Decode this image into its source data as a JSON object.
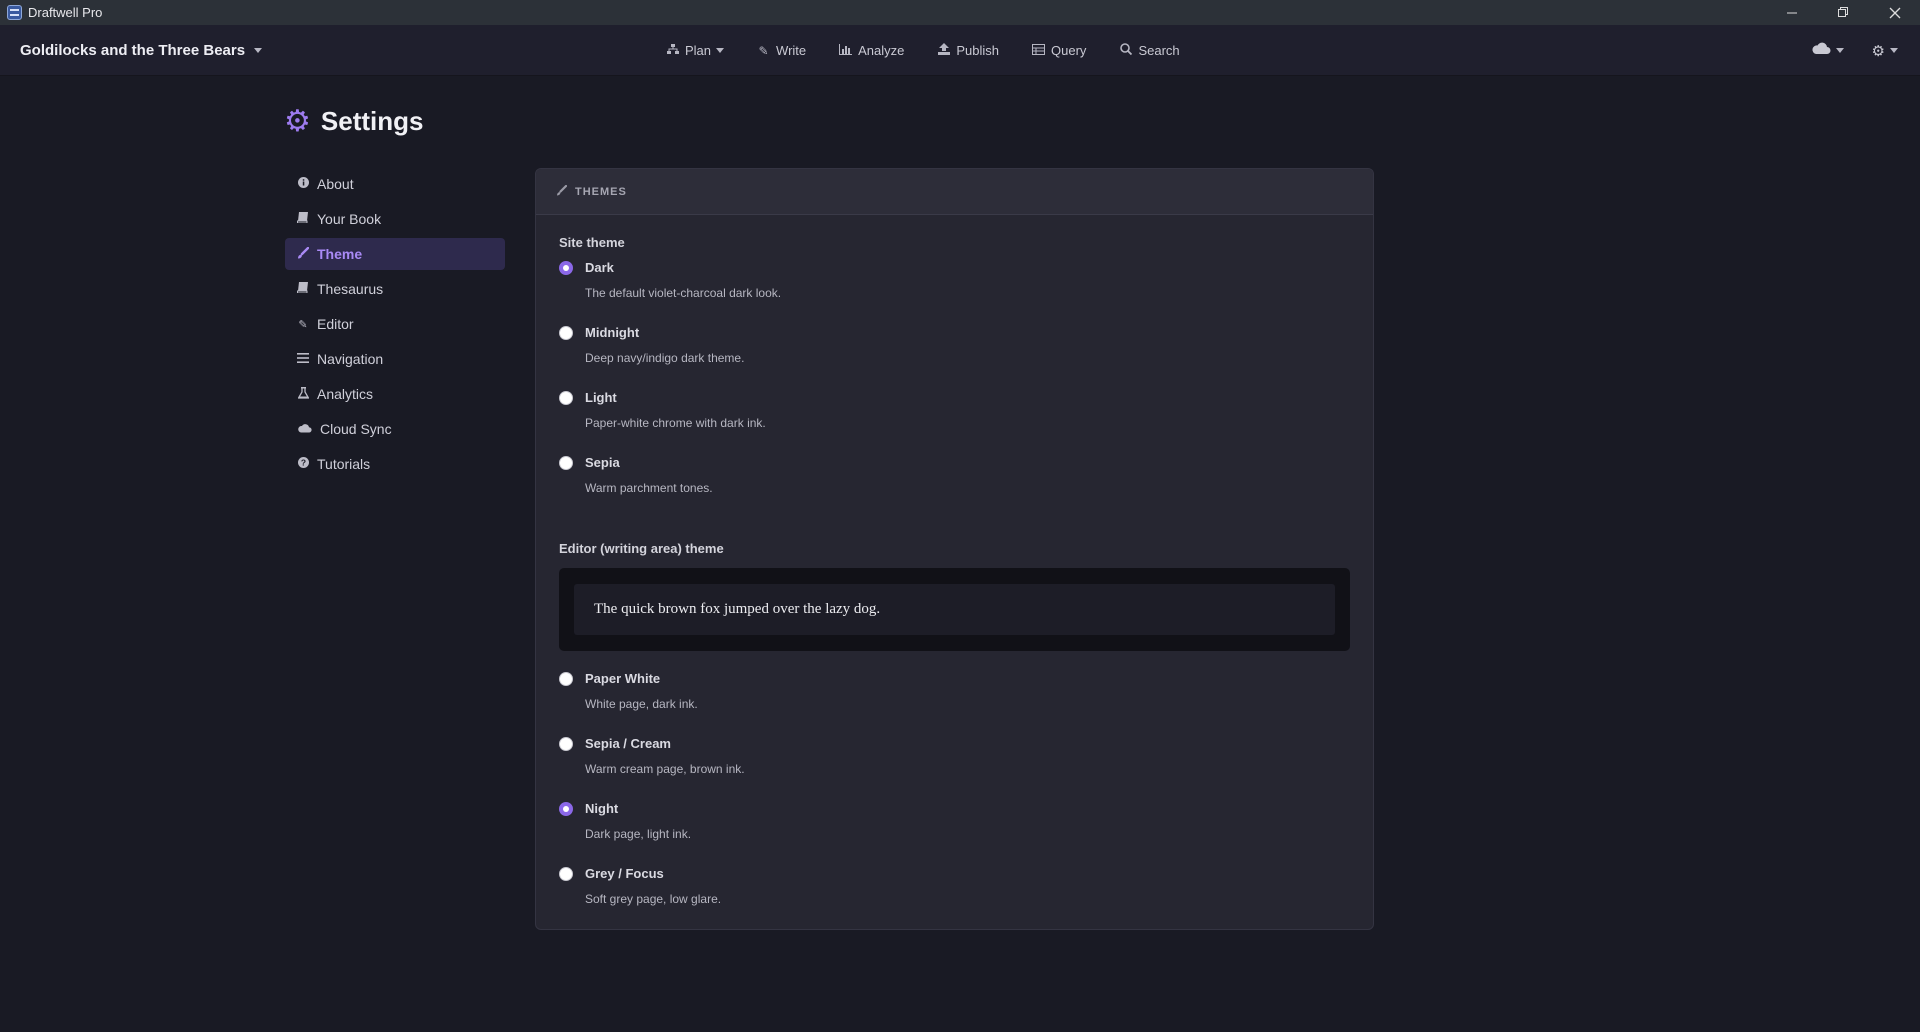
{
  "window": {
    "title": "Draftwell Pro",
    "controls": [
      "minimize",
      "restore",
      "close"
    ]
  },
  "topnav": {
    "project_title": "Goldilocks and the Three Bears",
    "items": [
      {
        "label": "Plan",
        "icon": "sitemap-icon",
        "has_dropdown": true
      },
      {
        "label": "Write",
        "icon": "pencil-icon",
        "has_dropdown": false
      },
      {
        "label": "Analyze",
        "icon": "bar-chart-icon",
        "has_dropdown": false
      },
      {
        "label": "Publish",
        "icon": "upload-icon",
        "has_dropdown": false
      },
      {
        "label": "Query",
        "icon": "table-icon",
        "has_dropdown": false
      },
      {
        "label": "Search",
        "icon": "search-icon",
        "has_dropdown": false
      }
    ],
    "right": [
      {
        "icon": "cloud-icon",
        "has_dropdown": true
      },
      {
        "icon": "gear-icon",
        "has_dropdown": true
      }
    ]
  },
  "settings": {
    "title": "Settings",
    "sidebar": [
      {
        "label": "About",
        "icon": "info-icon",
        "active": false
      },
      {
        "label": "Your Book",
        "icon": "book-icon",
        "active": false
      },
      {
        "label": "Theme",
        "icon": "paintbrush-icon",
        "active": true
      },
      {
        "label": "Thesaurus",
        "icon": "book-icon",
        "active": false
      },
      {
        "label": "Editor",
        "icon": "pencil-icon",
        "active": false
      },
      {
        "label": "Navigation",
        "icon": "menu-icon",
        "active": false
      },
      {
        "label": "Analytics",
        "icon": "flask-icon",
        "active": false
      },
      {
        "label": "Cloud Sync",
        "icon": "cloud-icon",
        "active": false
      },
      {
        "label": "Tutorials",
        "icon": "question-icon",
        "active": false
      }
    ]
  },
  "panel": {
    "header": "THEMES",
    "site_theme": {
      "label": "Site theme",
      "options": [
        {
          "name": "Dark",
          "desc": "The default violet-charcoal dark look.",
          "checked": true
        },
        {
          "name": "Midnight",
          "desc": "Deep navy/indigo dark theme.",
          "checked": false
        },
        {
          "name": "Light",
          "desc": "Paper-white chrome with dark ink.",
          "checked": false
        },
        {
          "name": "Sepia",
          "desc": "Warm parchment tones.",
          "checked": false
        }
      ]
    },
    "editor_theme": {
      "label": "Editor (writing area) theme",
      "preview_text": "The quick brown fox jumped over the lazy dog.",
      "options": [
        {
          "name": "Paper White",
          "desc": "White page, dark ink.",
          "checked": false
        },
        {
          "name": "Sepia / Cream",
          "desc": "Warm cream page, brown ink.",
          "checked": false
        },
        {
          "name": "Night",
          "desc": "Dark page, light ink.",
          "checked": true
        },
        {
          "name": "Grey / Focus",
          "desc": "Soft grey page, low glare.",
          "checked": false
        }
      ]
    }
  },
  "colors": {
    "accent": "#8b68e8",
    "background": "#191a24",
    "panel": "#262631",
    "nav": "#1f1f2d"
  }
}
